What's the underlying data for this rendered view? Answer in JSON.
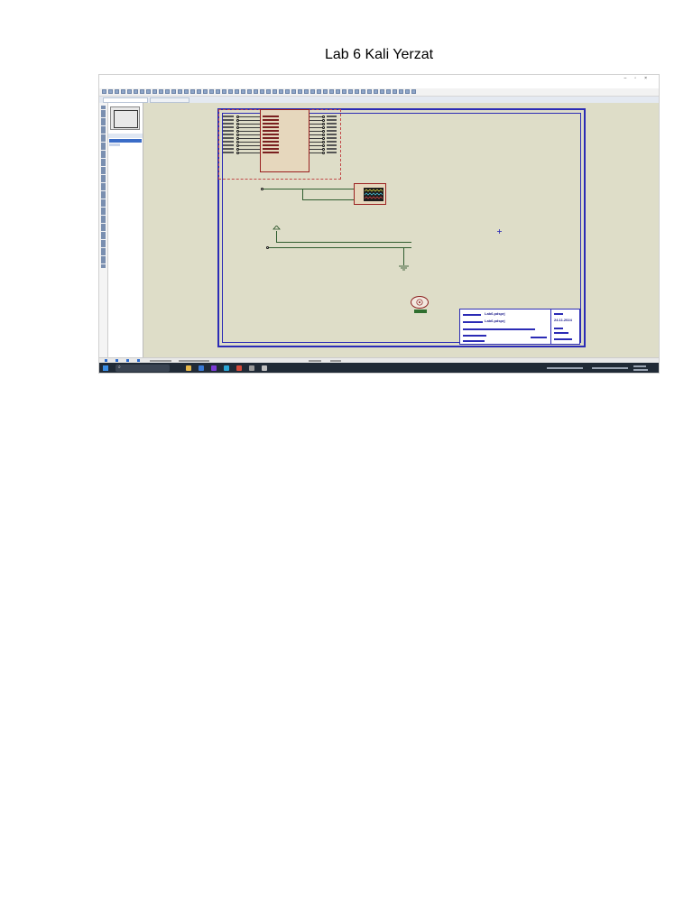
{
  "document": {
    "title": "Lab 6 Kali Yerzat"
  },
  "screenshot": {
    "title_block": {
      "file_name_value": "Lab6.pdsprj",
      "sheet_title_value": "Lab6.pdsprj",
      "date_value": "24.11.2024"
    },
    "colors": {
      "sheet_border": "#2b2bb5",
      "canvas_background": "#deddc8",
      "component_outline": "#9a2020",
      "component_fill": "#e6d7bd",
      "taskbar": "#202a36"
    },
    "icons": [
      "window-close-icon",
      "window-maximize-icon",
      "window-minimize-icon",
      "search-icon",
      "oscilloscope-icon",
      "motor-icon",
      "ground-icon"
    ]
  }
}
